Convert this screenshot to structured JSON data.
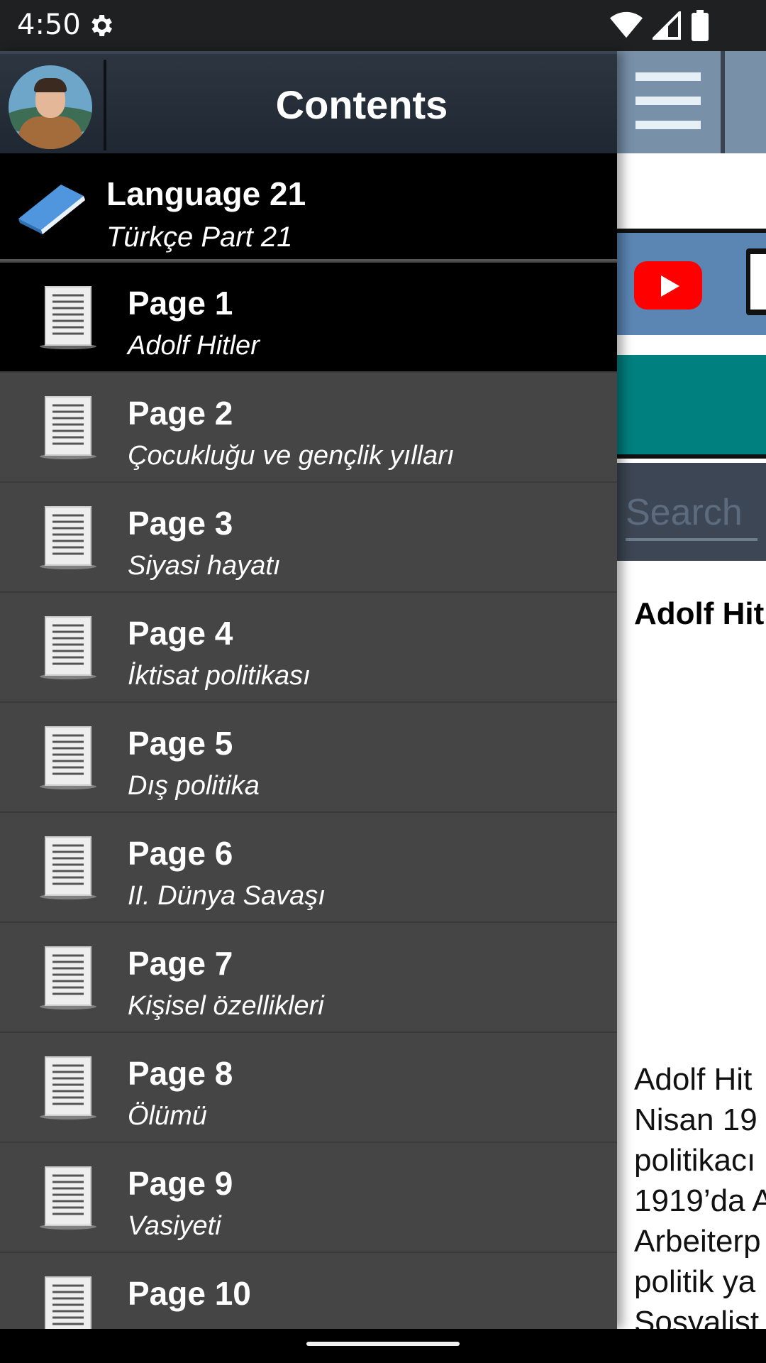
{
  "status_bar": {
    "time": "4:50",
    "icons": [
      "settings-gear-icon",
      "wifi-icon",
      "signal-icon",
      "battery-icon"
    ]
  },
  "drawer": {
    "title": "Contents",
    "avatar_icon": "avatar-portrait",
    "language": {
      "title": "Language 21",
      "subtitle": "Türkçe Part 21",
      "icon": "book-icon"
    },
    "items": [
      {
        "title": "Page 1",
        "subtitle": "Adolf Hitler",
        "selected": true
      },
      {
        "title": "Page 2",
        "subtitle": "Çocukluğu ve gençlik yılları",
        "selected": false
      },
      {
        "title": "Page 3",
        "subtitle": "Siyasi hayatı",
        "selected": false
      },
      {
        "title": "Page 4",
        "subtitle": "İktisat politikası",
        "selected": false
      },
      {
        "title": "Page 5",
        "subtitle": "Dış politika",
        "selected": false
      },
      {
        "title": "Page 6",
        "subtitle": "II. Dünya Savaşı",
        "selected": false
      },
      {
        "title": "Page 7",
        "subtitle": "Kişisel özellikleri",
        "selected": false
      },
      {
        "title": "Page 8",
        "subtitle": "Ölümü",
        "selected": false
      },
      {
        "title": "Page 9",
        "subtitle": "Vasiyeti",
        "selected": false
      },
      {
        "title": "Page 10",
        "subtitle": "",
        "selected": false
      }
    ]
  },
  "background_app": {
    "search_placeholder": "Search",
    "article_title": "Adolf Hit",
    "paragraph_lines": [
      "Adolf Hit",
      "Nisan 19",
      "politikacı",
      "1919’da A",
      "Arbeiterp",
      "politik ya",
      "Sosyalist"
    ]
  },
  "colors": {
    "drawer_bg": "#454545",
    "selected_bg": "#000000",
    "header_bg": "#2c3540",
    "teal": "#00807f",
    "youtube_red": "#ff0000"
  }
}
